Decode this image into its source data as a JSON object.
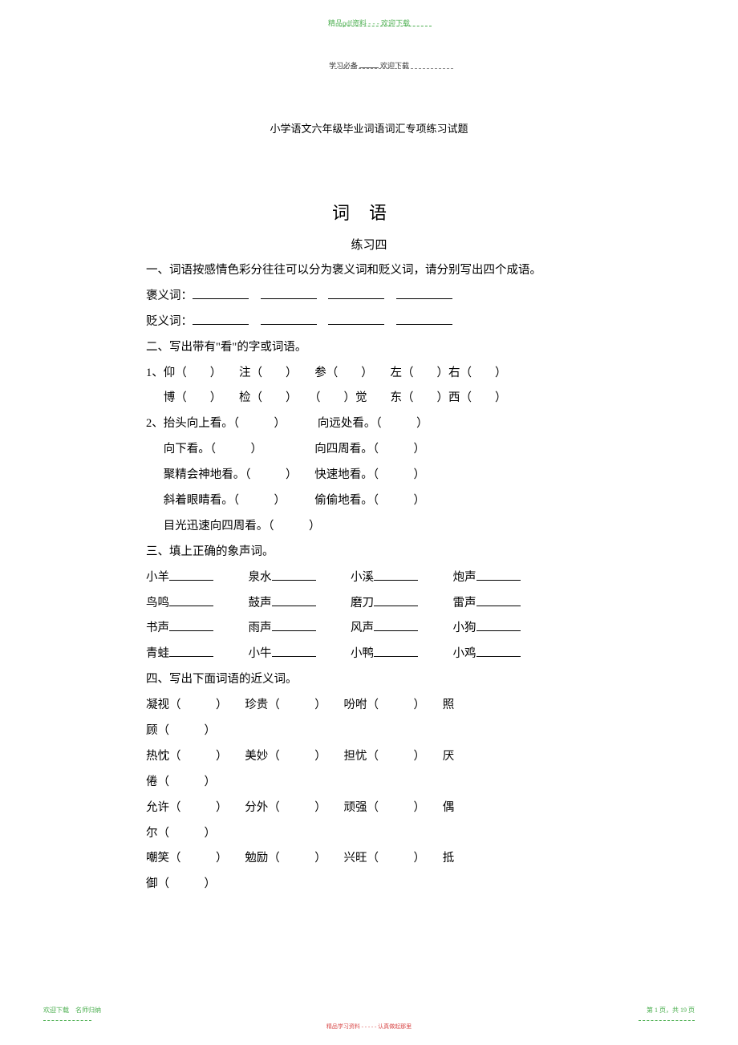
{
  "header": {
    "top_green": "精品pdf资料 - - - 欢迎下载",
    "row2_left": "学习必备",
    "row2_right": "欢迎下载"
  },
  "doc_title": "小学语文六年级毕业词语词汇专项练习试题",
  "main_title": "词语",
  "sub_title": "练习四",
  "section1": {
    "heading": "一、词语按感情色彩分往往可以分为褒义词和贬义词，请分别写出四个成语。",
    "row1_label": "褒义词：",
    "row2_label": "贬义词："
  },
  "section2": {
    "heading": "二、写出带有\"看\"的字或词语。",
    "row1": "1、仰（　　）　　注（　　）　　参（　　）　　左（　　）右（　　）",
    "row1b": "　  博（　　）　　检（　　）　　（　　）觉　　东（　　）西（　　）",
    "row2": "2、抬头向上看。（　　　）　　　 向远处看。（　　　）",
    "row2b": "　  向下看。（　　　）　　　　　向四周看。（　　　）",
    "row2c": "　  聚精会神地看。（　　　）　　快速地看。（　　　）",
    "row2d": "　  斜着眼睛看。（　　　）　　　偷偷地看。（　　　）",
    "row2e": "　  目光迅速向四周看。（　　　）"
  },
  "section3": {
    "heading": "三、填上正确的象声词。",
    "items": [
      [
        "小羊",
        "泉水",
        "小溪",
        "炮声"
      ],
      [
        "鸟鸣",
        "鼓声",
        "磨刀",
        "雷声"
      ],
      [
        "书声",
        "雨声",
        "风声",
        "小狗"
      ],
      [
        "青蛙",
        "小牛",
        "小鸭",
        "小鸡"
      ]
    ]
  },
  "section4": {
    "heading": "四、写出下面词语的近义词。",
    "rows": [
      [
        "凝视",
        "珍贵",
        "吩咐",
        "照"
      ],
      [
        "顾"
      ],
      [
        "热忱",
        "美妙",
        "担忧",
        "厌"
      ],
      [
        "倦"
      ],
      [
        "允许",
        "分外",
        "顽强",
        "偶"
      ],
      [
        "尔"
      ],
      [
        "嘲笑",
        "勉励",
        "兴旺",
        "抵"
      ],
      [
        "御"
      ]
    ]
  },
  "footer": {
    "left": "欢迎下载　名师归纳",
    "center": "精品学习资料 - - - - - 认真做起那里",
    "right_prefix": "第 ",
    "page_current": "1",
    "right_mid": " 页，共 ",
    "page_total": "19",
    "right_suffix": " 页"
  }
}
